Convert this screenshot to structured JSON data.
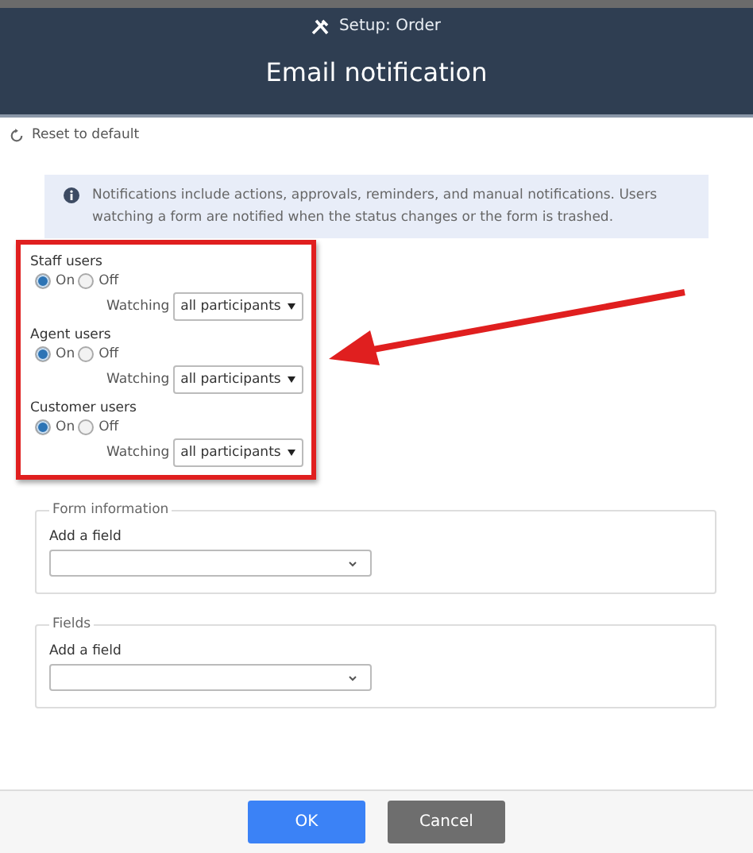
{
  "header": {
    "subtitle": "Setup: Order",
    "title": "Email notification"
  },
  "reset": {
    "label": "Reset to default"
  },
  "info": {
    "text": "Notifications include actions, approvals, reminders, and manual notifications. Users watching a form are notified when the status changes or the form is trashed."
  },
  "user_groups": [
    {
      "label": "Staff users",
      "options": [
        {
          "label": "On",
          "selected": true
        },
        {
          "label": "Off",
          "selected": false
        }
      ],
      "watching_label": "Watching",
      "watching_value": "all participants"
    },
    {
      "label": "Agent users",
      "options": [
        {
          "label": "On",
          "selected": true
        },
        {
          "label": "Off",
          "selected": false
        }
      ],
      "watching_label": "Watching",
      "watching_value": "all participants"
    },
    {
      "label": "Customer users",
      "options": [
        {
          "label": "On",
          "selected": true
        },
        {
          "label": "Off",
          "selected": false
        }
      ],
      "watching_label": "Watching",
      "watching_value": "all participants"
    }
  ],
  "sections": [
    {
      "legend": "Form information",
      "field_label": "Add a field"
    },
    {
      "legend": "Fields",
      "field_label": "Add a field"
    }
  ],
  "buttons": [
    {
      "label": "OK",
      "kind": "primary"
    },
    {
      "label": "Cancel",
      "kind": "secondary"
    }
  ]
}
